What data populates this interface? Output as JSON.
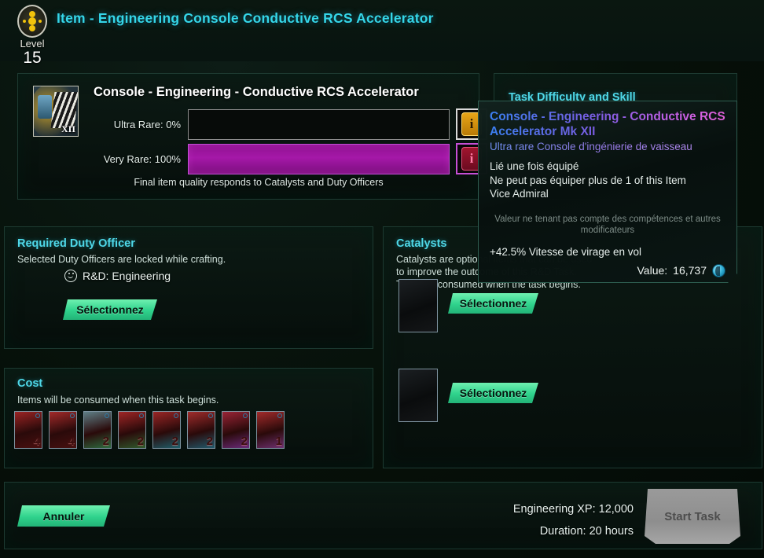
{
  "header": {
    "level_word": "Level",
    "level_number": "15",
    "title": "Item - Engineering Console Conductive RCS Accelerator",
    "title_color": "#35d6e8"
  },
  "item_card": {
    "icon_mark": "XII",
    "name": "Console - Engineering - Conductive RCS Accelerator",
    "ultra_rare_label": "Ultra Rare: 0%",
    "ultra_rare_percent": 0,
    "very_rare_label": "Very Rare: 100%",
    "very_rare_percent": 100,
    "very_rare_color": "#a518a8",
    "info_glyph": "i",
    "footnote": "Final item quality responds to Catalysts and Duty Officers"
  },
  "task_panel": {
    "title": "Task Difficulty and Skill"
  },
  "tooltip": {
    "title": "Console - Engineering - Conductive RCS Accelerator Mk XII",
    "subtitle": "Ultra rare Console d'ingénierie de vaisseau",
    "lines": [
      "Lié une fois équipé",
      "Ne peut pas équiper plus de 1 of this Item",
      "Vice Admiral"
    ],
    "note": "Valeur ne tenant pas compte des compétences et autres modificateurs",
    "effect": "+42.5% Vitesse de virage en vol",
    "value_label": "Value:",
    "value_amount": "16,737",
    "currency_icon": "dilithium-icon"
  },
  "duty_officer": {
    "title": "Required Duty Officer",
    "subtitle": "Selected Duty Officers are locked while crafting.",
    "requirement": "R&D: Engineering",
    "requirement_icon": "rd-circle-icon",
    "select_label": "Sélectionnez"
  },
  "catalysts": {
    "title": "Catalysts",
    "subtitle": "Catalysts are optional items that can be used to improve the outcome of this R&D Task. They are consumed when the task begins.",
    "slots": [
      {
        "select_label": "Sélectionnez"
      },
      {
        "select_label": "Sélectionnez"
      }
    ]
  },
  "cost": {
    "title": "Cost",
    "subtitle": "Items will be consumed when this task begins.",
    "items": [
      {
        "qty": "4",
        "tint": "#9c2424",
        "tint2": "#4a0f0f"
      },
      {
        "qty": "4",
        "tint": "#a32a2a",
        "tint2": "#471010"
      },
      {
        "qty": "2",
        "tint": "#5f7f86",
        "tint2": "#2d6b3f"
      },
      {
        "qty": "2",
        "tint": "#a02626",
        "tint2": "#2f5a2c"
      },
      {
        "qty": "2",
        "tint": "#9b2626",
        "tint2": "#1f5f6b"
      },
      {
        "qty": "2",
        "tint": "#a02c2c",
        "tint2": "#21596b"
      },
      {
        "qty": "2",
        "tint": "#9a2436",
        "tint2": "#6b2a7a"
      },
      {
        "qty": "1",
        "tint": "#a32b2b",
        "tint2": "#6e3070"
      }
    ]
  },
  "bottom": {
    "cancel_label": "Annuler",
    "xp_line": "Engineering XP: 12,000",
    "duration_line": "Duration: 20 hours",
    "start_label": "Start Task"
  }
}
